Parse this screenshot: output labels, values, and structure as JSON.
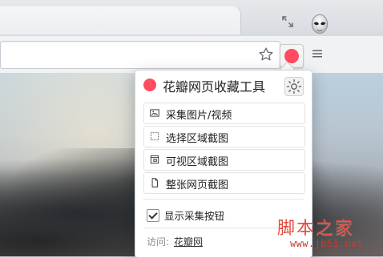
{
  "popup": {
    "title": "花瓣网页收藏工具",
    "items": [
      {
        "label": "采集图片/视频",
        "icon": "image-icon"
      },
      {
        "label": "选择区域截图",
        "icon": "selection-icon"
      },
      {
        "label": "可视区域截图",
        "icon": "visible-area-icon"
      },
      {
        "label": "整张网页截图",
        "icon": "full-page-icon"
      }
    ],
    "checkbox_label": "显示采集按钮",
    "checkbox_checked": true,
    "visit_prefix": "访问:",
    "visit_link": "花瓣网"
  },
  "watermark": {
    "title": "脚本之家",
    "url": "www.jb51.net"
  },
  "colors": {
    "brand": "#ff4c61",
    "watermark": "#e24a3d"
  }
}
